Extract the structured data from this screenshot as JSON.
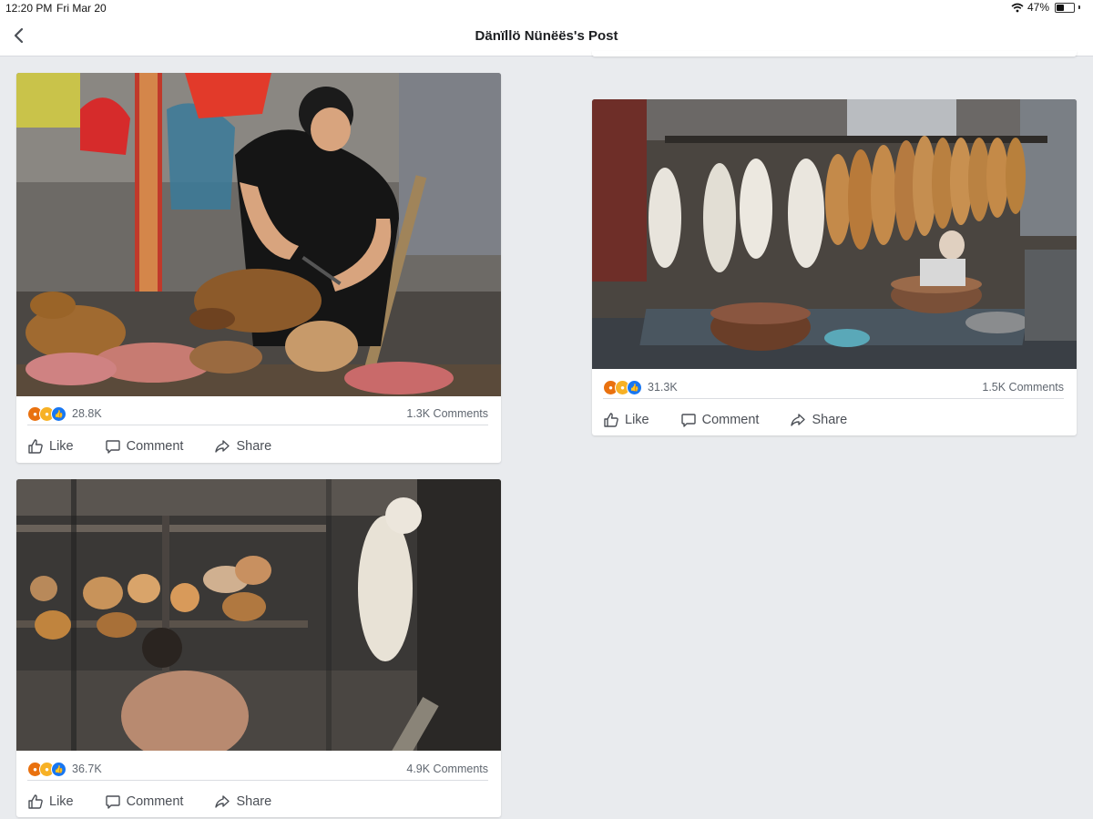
{
  "status_bar": {
    "time": "12:20 PM",
    "date": "Fri Mar 20",
    "battery": "47%",
    "battery_level": 0.47
  },
  "header": {
    "title": "Dänïllö Nünëës's Post",
    "back_icon": "chevron-left-icon"
  },
  "posts": [
    {
      "reaction_icons": [
        "angry-icon",
        "sad-icon",
        "like-icon"
      ],
      "reaction_count": "28.8K",
      "comments": "1.3K Comments",
      "actions": {
        "like": "Like",
        "comment": "Comment",
        "share": "Share"
      }
    },
    {
      "reaction_icons": [
        "angry-icon",
        "sad-icon",
        "like-icon"
      ],
      "reaction_count": "31.3K",
      "comments": "1.5K Comments",
      "actions": {
        "like": "Like",
        "comment": "Comment",
        "share": "Share"
      }
    },
    {
      "reaction_icons": [
        "angry-icon",
        "sad-icon",
        "like-icon"
      ],
      "reaction_count": "36.7K",
      "comments": "4.9K Comments",
      "actions": {
        "like": "Like",
        "comment": "Comment",
        "share": "Share"
      }
    }
  ],
  "colors": {
    "background": "#e9ebee",
    "angry": "#e9710f",
    "sad": "#f7b125",
    "like": "#1877f2"
  }
}
